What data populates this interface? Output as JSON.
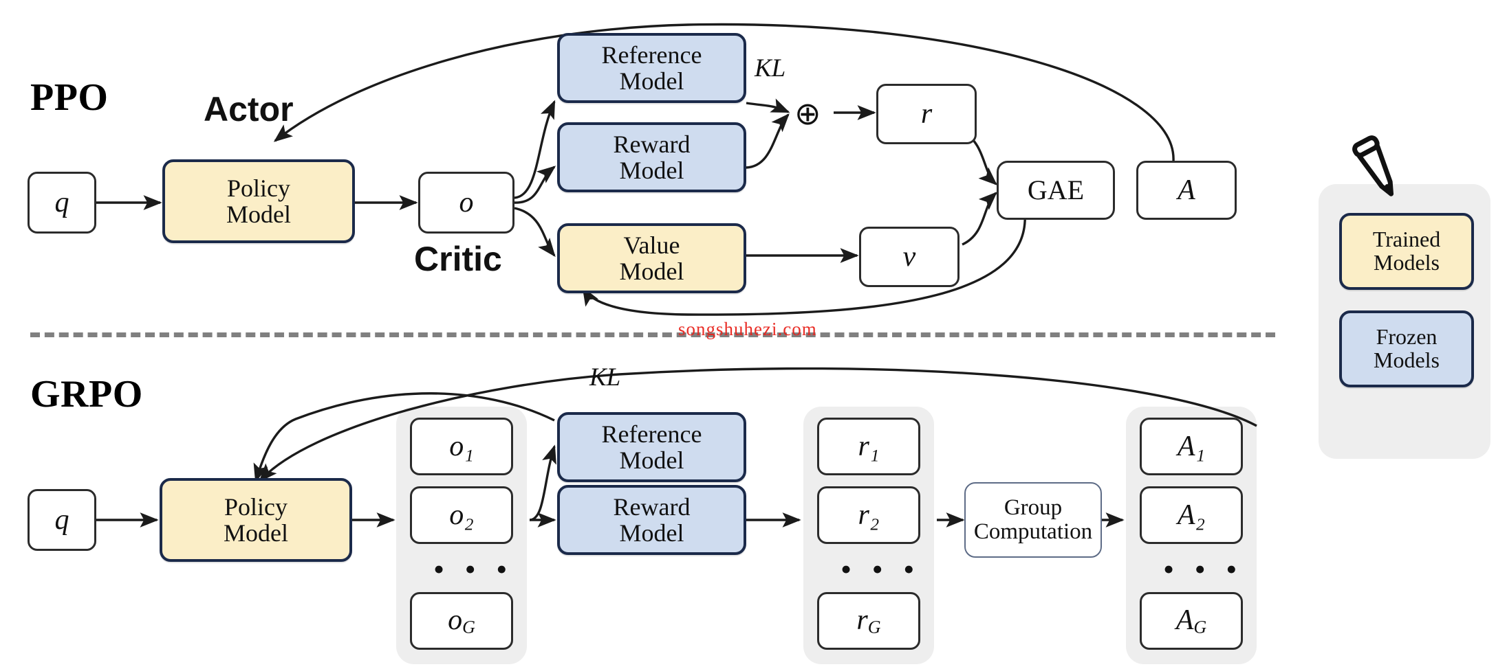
{
  "figure": {
    "title_ppo": "PPO",
    "title_grpo": "GRPO",
    "watermark": "songshuhezi.com",
    "colors": {
      "trained_fill": "#fbeec7",
      "frozen_fill": "#cfdcef",
      "node_border": "#1b2a4a",
      "group_panel": "#eeeeee",
      "divider": "#808080",
      "watermark": "#e8231c"
    }
  },
  "ppo": {
    "label": "PPO",
    "role_actor": "Actor",
    "role_critic": "Critic",
    "kl_label": "KL",
    "oplus": "⊕",
    "nodes": {
      "q": "q",
      "policy_model": {
        "line1": "Policy",
        "line2": "Model"
      },
      "o": "o",
      "reference_model": {
        "line1": "Reference",
        "line2": "Model"
      },
      "reward_model": {
        "line1": "Reward",
        "line2": "Model"
      },
      "value_model": {
        "line1": "Value",
        "line2": "Model"
      },
      "r": "r",
      "v": "v",
      "gae": "GAE",
      "A": "A"
    }
  },
  "grpo": {
    "label": "GRPO",
    "kl_label": "KL",
    "nodes": {
      "q": "q",
      "policy_model": {
        "line1": "Policy",
        "line2": "Model"
      },
      "reference_model": {
        "line1": "Reference",
        "line2": "Model"
      },
      "reward_model": {
        "line1": "Reward",
        "line2": "Model"
      },
      "group_computation": {
        "line1": "Group",
        "line2": "Computation"
      }
    },
    "outputs": {
      "first": "o₁",
      "second": "o₂",
      "ellipsis": "• • •",
      "last": "o_G"
    },
    "rewards": {
      "first": "r₁",
      "second": "r₂",
      "ellipsis": "• • •",
      "last": "r_G"
    },
    "advantages": {
      "first": "A₁",
      "second": "A₂",
      "ellipsis": "• • •",
      "last": "A_G"
    }
  },
  "legend": {
    "icon": "pencil-icon",
    "trained": {
      "line1": "Trained",
      "line2": "Models"
    },
    "frozen": {
      "line1": "Frozen",
      "line2": "Models"
    }
  }
}
